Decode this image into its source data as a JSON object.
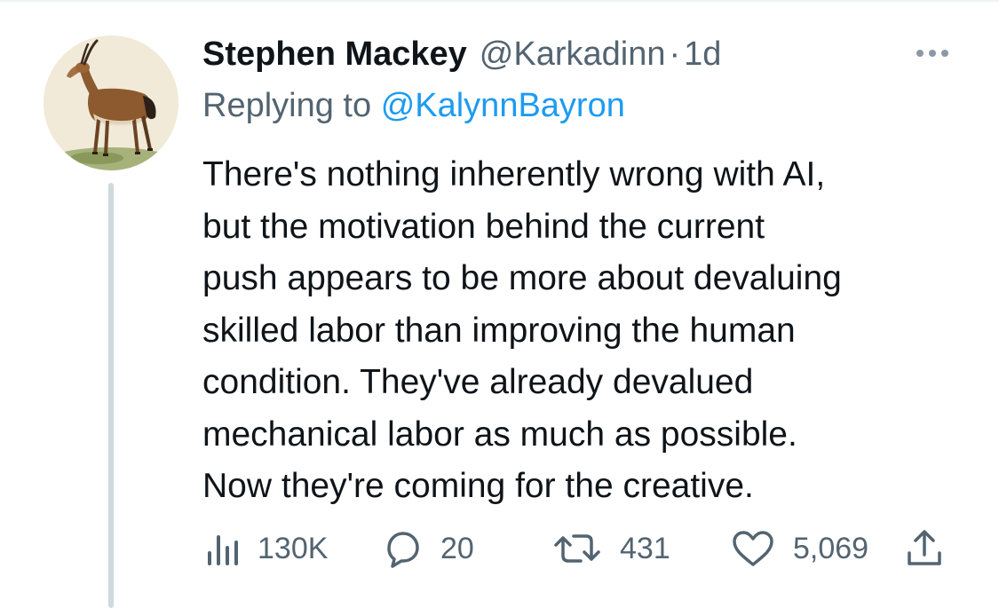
{
  "tweet": {
    "display_name": "Stephen Mackey",
    "handle": "@Karkadinn",
    "separator": "·",
    "time": "1d",
    "replying_prefix": "Replying to",
    "replying_to": "@KalynnBayron",
    "text_lines": [
      "There's nothing inherently wrong with AI,",
      "but the motivation behind the current",
      "push appears to be more about devaluing",
      "skilled labor than improving the human",
      "condition. They've already devalued",
      "mechanical labor as much as possible.",
      "Now they're coming for the creative."
    ]
  },
  "actions": {
    "views": {
      "icon": "views-icon",
      "count": "130K"
    },
    "replies": {
      "icon": "reply-icon",
      "count": "20"
    },
    "retweets": {
      "icon": "retweet-icon",
      "count": "431"
    },
    "likes": {
      "icon": "heart-icon",
      "count": "5,069"
    },
    "share": {
      "icon": "share-icon"
    }
  },
  "more_menu": {
    "icon": "more-dots-icon"
  },
  "avatar": {
    "icon": "avatar-antelope-painting"
  },
  "colors": {
    "text": "#0f1419",
    "secondary": "#536471",
    "link": "#1d9bf0",
    "thread_line": "#cfd9de"
  }
}
